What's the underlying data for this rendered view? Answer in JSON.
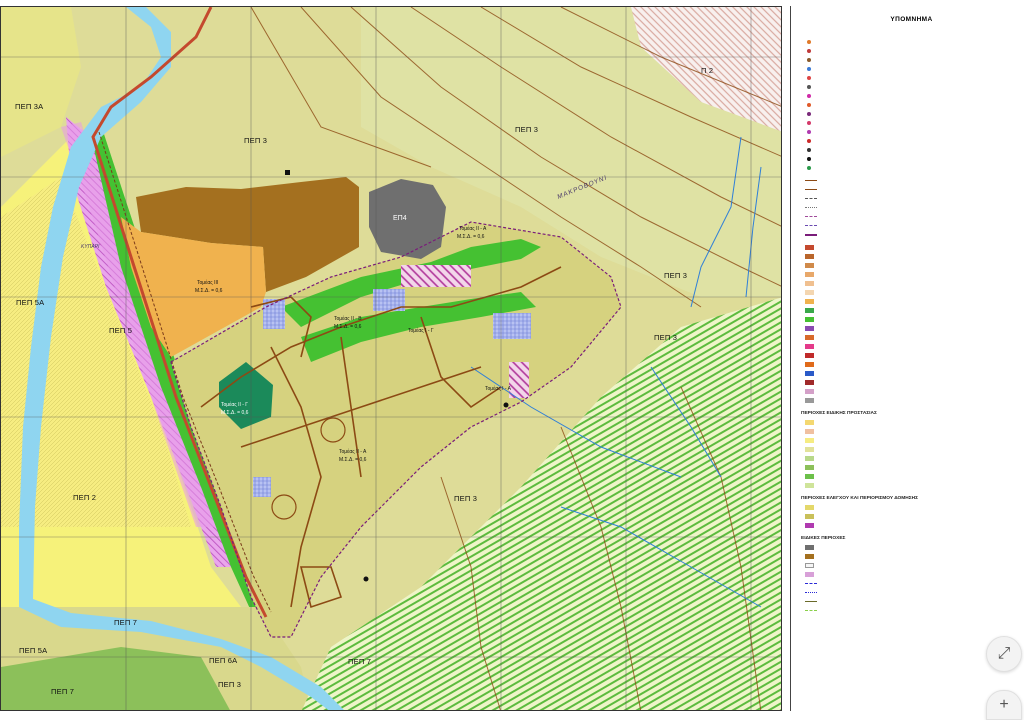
{
  "legend": {
    "title": "ΥΠΟΜΝΗΜΑ",
    "sec_special_protection": "ΠΕΡΙΟΧΕΣ ΕΙΔΙΚΗΣ ΠΡΟΣΤΑΣΙΑΣ",
    "sec_control": "ΠΕΡΙΟΧΕΣ ΕΛΕΓΧΟΥ ΚΑΙ ΠΕΡΙΟΡΙΣΜΟΥ ΔΟΜΗΣΗΣ",
    "sec_special": "ΕΙΔΙΚΕΣ ΠΕΡΙΟΧΕΣ"
  },
  "map_labels": {
    "pep3_a": "ΠΕΠ 3",
    "pep3_b": "ΠΕΠ 3",
    "pep3_c": "ΠΕΠ 3",
    "pep3_d": "ΠΕΠ 3",
    "pep3_e": "ΠΕΠ 3",
    "pep3_f": "ΠΕΠ 3",
    "pep3a": "ΠΕΠ 3Α",
    "pep5a_a": "ΠΕΠ 5Α",
    "pep5a_b": "ΠΕΠ 5Α",
    "pep5": "ΠΕΠ 5",
    "pep2": "ΠΕΠ 2",
    "pep6a": "ΠΕΠ 6Α",
    "pep7_a": "ΠΕΠ 7",
    "pep7_b": "ΠΕΠ 7",
    "pep7_c": "ΠΕΠ 7",
    "p2": "Π 2",
    "ep4": "ΕΠ4",
    "makrovouni": "ΜΑΚΡΟΒΟΥΝΙ",
    "kypari": "ΚΥΠΑΡΙ",
    "tomeas_iii": "Τομέας ΙΙΙ",
    "mta_06_a": "Μ.Σ.Δ. = 0,6",
    "tomeas_iia": "Τομέας ΙΙ - Α",
    "mta_06_b": "Μ.Σ.Δ. = 0,6",
    "tomeas_iib": "Τομέας ΙΙ - Β",
    "mta_06_c": "Μ.Σ.Δ. = 0,6",
    "tomeas_ig": "Τομέας Ι - Γ",
    "tomeas_iiv": "Τομέας ΙΙ - Γ",
    "mta_06_d": "Μ.Σ.Δ. = 0,6",
    "tomeas_ia": "Τομέας Ι - Α",
    "tomeas_iia2": "Τομέας ΙΙ - Α",
    "mta_06_e": "Μ.Σ.Δ. = 0,6"
  },
  "colors": {
    "background_zone": "#e2e29a",
    "settlement": "#d8d486",
    "green_corridor": "#4dc63a",
    "brown_zone": "#a4701f",
    "orange_zone": "#f0b24e",
    "magenta_hatch": "#e79be9",
    "yellow_zone": "#f6f27a",
    "river": "#8fd5f0",
    "road": "#b9652b",
    "contour": "#8c4a14",
    "hatch_green": "#6cc04a",
    "teal_block": "#1b8a5a",
    "grey_block": "#777777"
  },
  "controls": {
    "fit_label": "⤢",
    "zoom_in_label": "+"
  }
}
